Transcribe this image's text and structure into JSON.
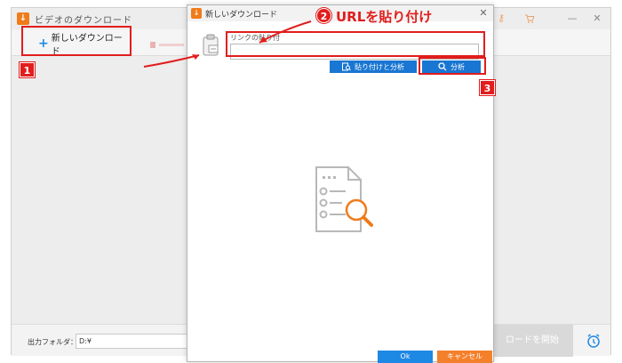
{
  "main_window": {
    "title": "ビデオのダウンロード",
    "new_download_label": "新しいダウンロード",
    "output_folder_label": "出力フォルダ：",
    "output_folder_value": "D:¥",
    "start_download_label": "ロードを開始"
  },
  "dialog": {
    "title": "新しいダウンロード",
    "link_label": "リンクの貼り付",
    "url_value": "",
    "paste_and_analyze_label": "貼り付けと分析",
    "analyze_label": "分析",
    "ok_label": "Ok",
    "cancel_label": "キャンセル"
  },
  "annotations": {
    "step1": "1",
    "step2": "2",
    "step3": "3",
    "paste_url_caption": "URLを貼り付け"
  },
  "colors": {
    "accent_blue": "#1976d2",
    "accent_orange": "#f5802b",
    "annotation_red": "#e11d1d"
  }
}
